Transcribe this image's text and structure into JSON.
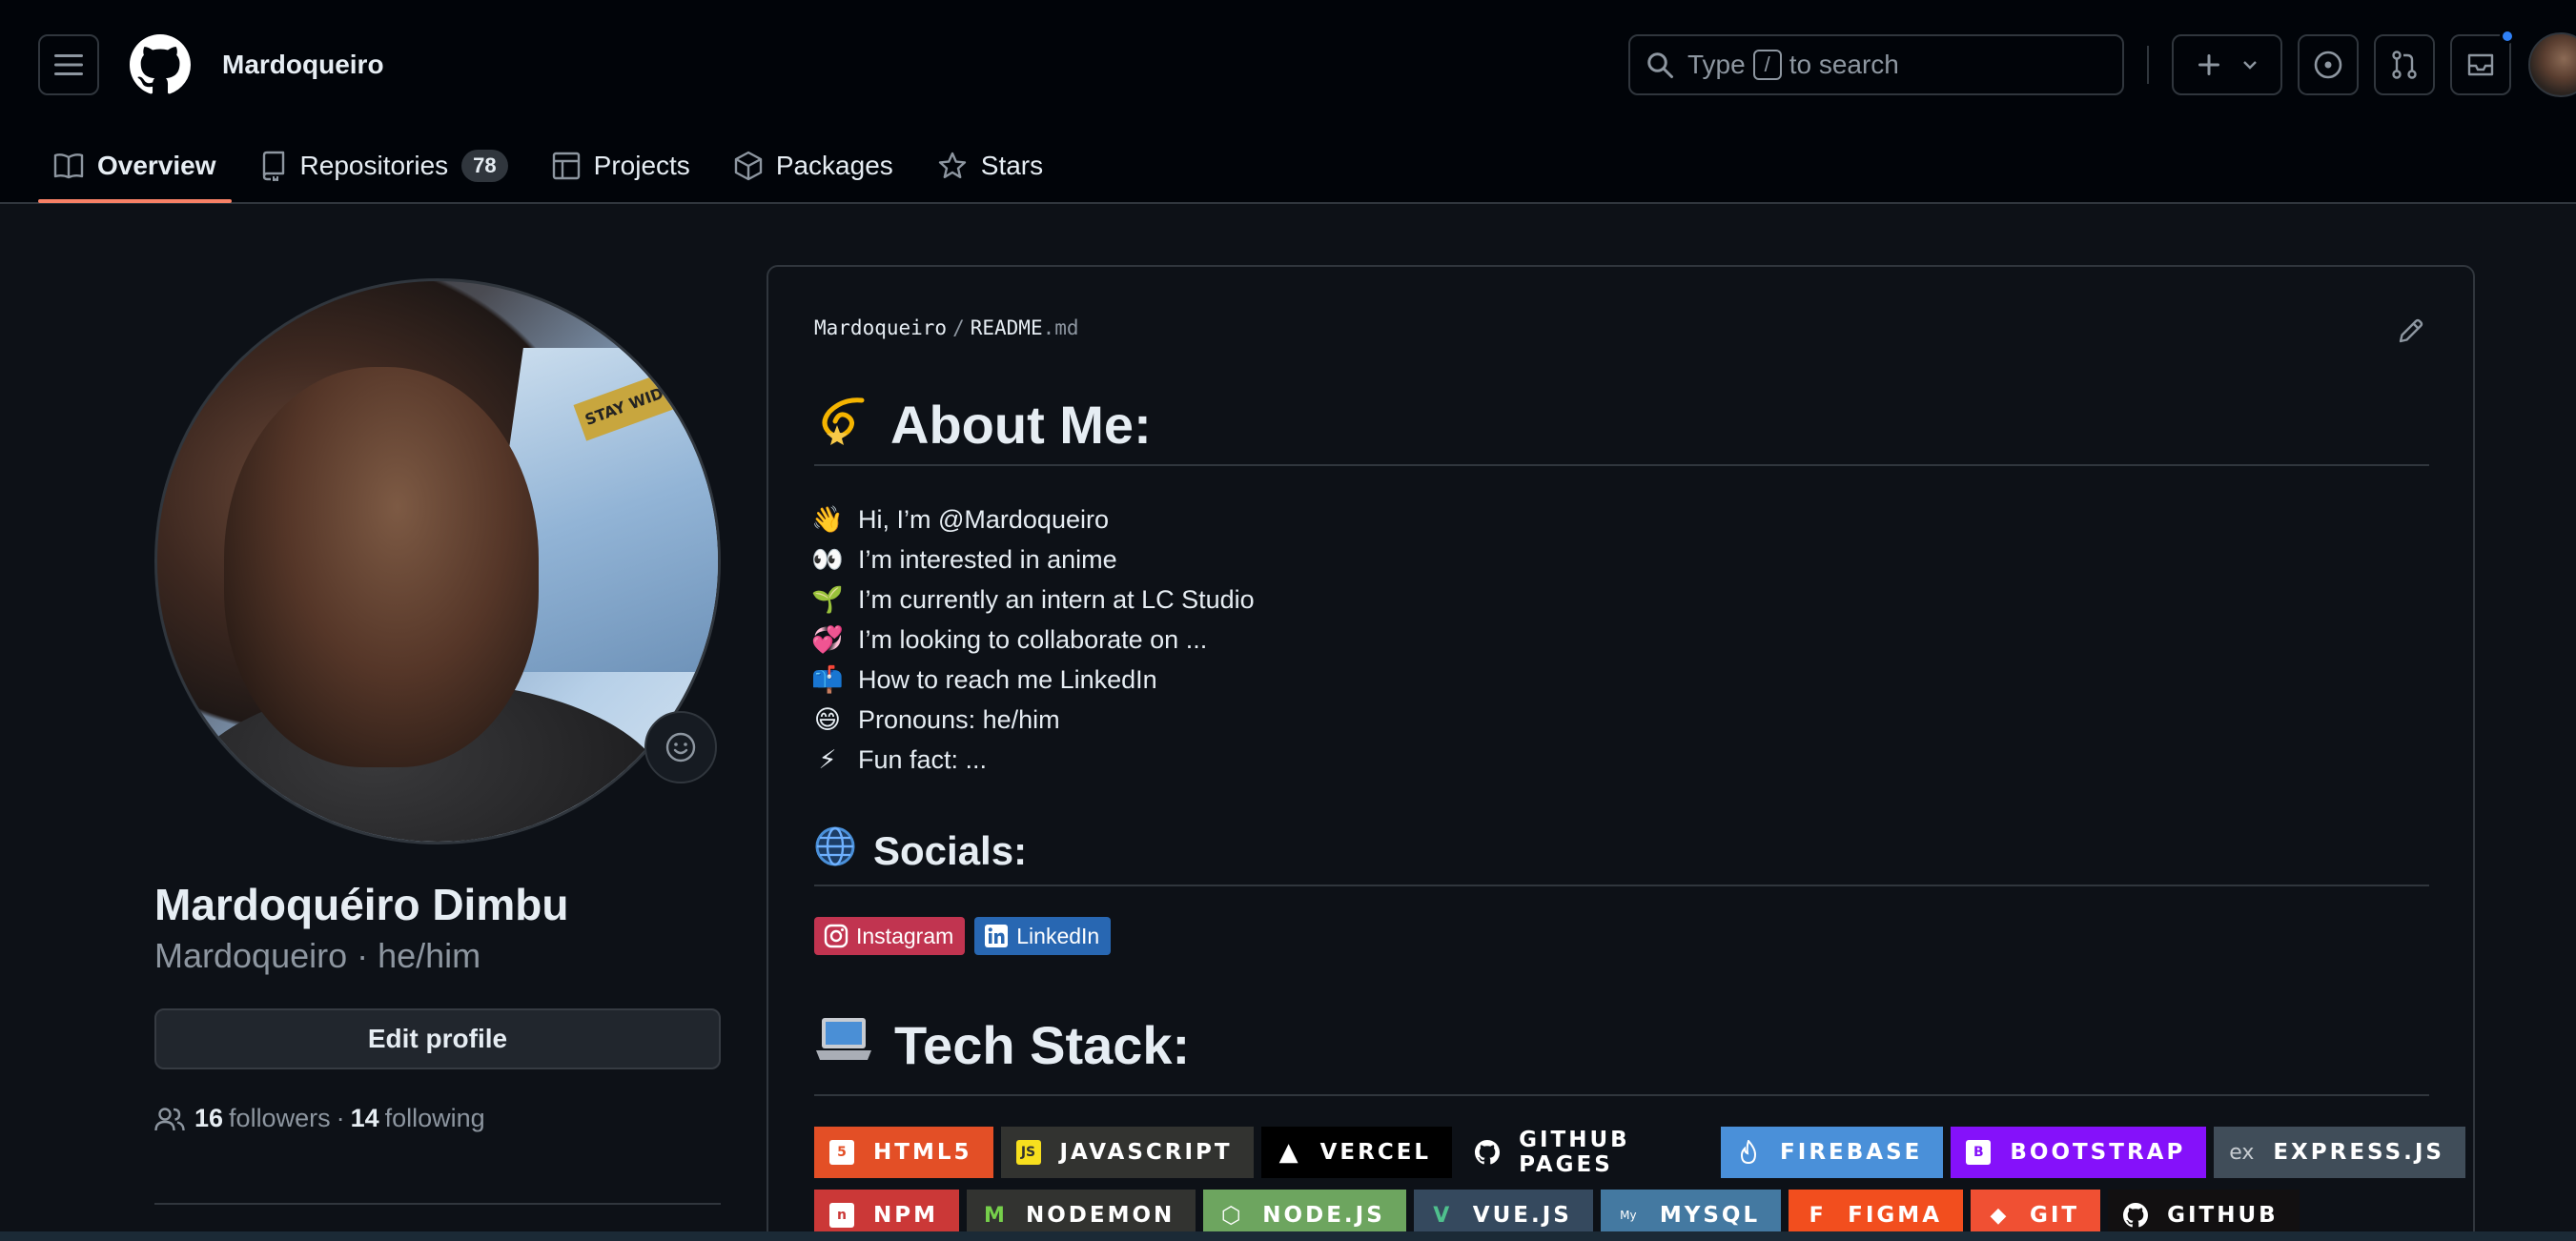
{
  "header": {
    "username": "Mardoqueiro",
    "search": {
      "prefix": "Type",
      "key": "/",
      "suffix": "to search"
    }
  },
  "tabs": [
    {
      "label": "Overview",
      "icon": "book-icon",
      "active": true
    },
    {
      "label": "Repositories",
      "icon": "repo-icon",
      "count": "78"
    },
    {
      "label": "Projects",
      "icon": "table-icon"
    },
    {
      "label": "Packages",
      "icon": "package-icon"
    },
    {
      "label": "Stars",
      "icon": "star-icon"
    }
  ],
  "profile": {
    "fullname": "Mardoquéiro Dimbu",
    "handle": "Mardoqueiro",
    "pronouns": "he/him",
    "subname": "Mardoqueiro · he/him",
    "edit_label": "Edit profile",
    "followers_count": "16",
    "followers_label": "followers",
    "dot": "·",
    "following_count": "14",
    "following_label": "following"
  },
  "readme": {
    "crumb_user": "Mardoqueiro",
    "crumb_sep": "/",
    "crumb_file": "README",
    "crumb_ext": ".md",
    "about_title": "About Me:",
    "about_items": [
      {
        "emoji": "👋",
        "text": "Hi, I’m @Mardoqueiro"
      },
      {
        "emoji": "👀",
        "text": "I’m interested in anime"
      },
      {
        "emoji": "🌱",
        "text": "I’m currently an intern at LC Studio"
      },
      {
        "emoji": "💞️",
        "text": "I’m looking to collaborate on ..."
      },
      {
        "emoji": "📫",
        "text": "How to reach me LinkedIn"
      },
      {
        "emoji": "😄",
        "text": "Pronouns: he/him"
      },
      {
        "emoji": "⚡",
        "text": "Fun fact: ..."
      }
    ],
    "socials_title": "Socials:",
    "socials": [
      {
        "label": "Instagram",
        "color": "#e4405f"
      },
      {
        "label": "LinkedIn",
        "color": "#0077b5"
      }
    ],
    "tech_title": "Tech Stack:",
    "tech_row1": [
      {
        "label": "HTML5",
        "bg": "#e34f26",
        "icon": "5"
      },
      {
        "label": "JAVASCRIPT",
        "bg": "#323330",
        "icon": "JS"
      },
      {
        "label": "VERCEL",
        "bg": "#000000",
        "icon": "▲"
      },
      {
        "label": "GITHUB PAGES",
        "bg": "#0d1117",
        "icon": "gh"
      },
      {
        "label": "FIREBASE",
        "bg": "#4a90d9",
        "icon": "🔥"
      },
      {
        "label": "BOOTSTRAP",
        "bg": "#8511fa",
        "icon": "B"
      },
      {
        "label": "EXPRESS.JS",
        "bg": "#404d59",
        "icon": "ex"
      }
    ],
    "tech_row2": [
      {
        "label": "NPM",
        "bg": "#cb3837",
        "icon": "n"
      },
      {
        "label": "NODEMON",
        "bg": "#323330",
        "icon": "M"
      },
      {
        "label": "NODE.JS",
        "bg": "#6da55f",
        "icon": "⬡"
      },
      {
        "label": "VUE.JS",
        "bg": "#35495e",
        "icon": "V"
      },
      {
        "label": "MYSQL",
        "bg": "#4479a1",
        "icon": "My"
      },
      {
        "label": "FIGMA",
        "bg": "#f24e1e",
        "icon": "F"
      },
      {
        "label": "GIT",
        "bg": "#f05033",
        "icon": "◆"
      },
      {
        "label": "GITHUB",
        "bg": "#121011",
        "icon": "gh"
      }
    ]
  }
}
